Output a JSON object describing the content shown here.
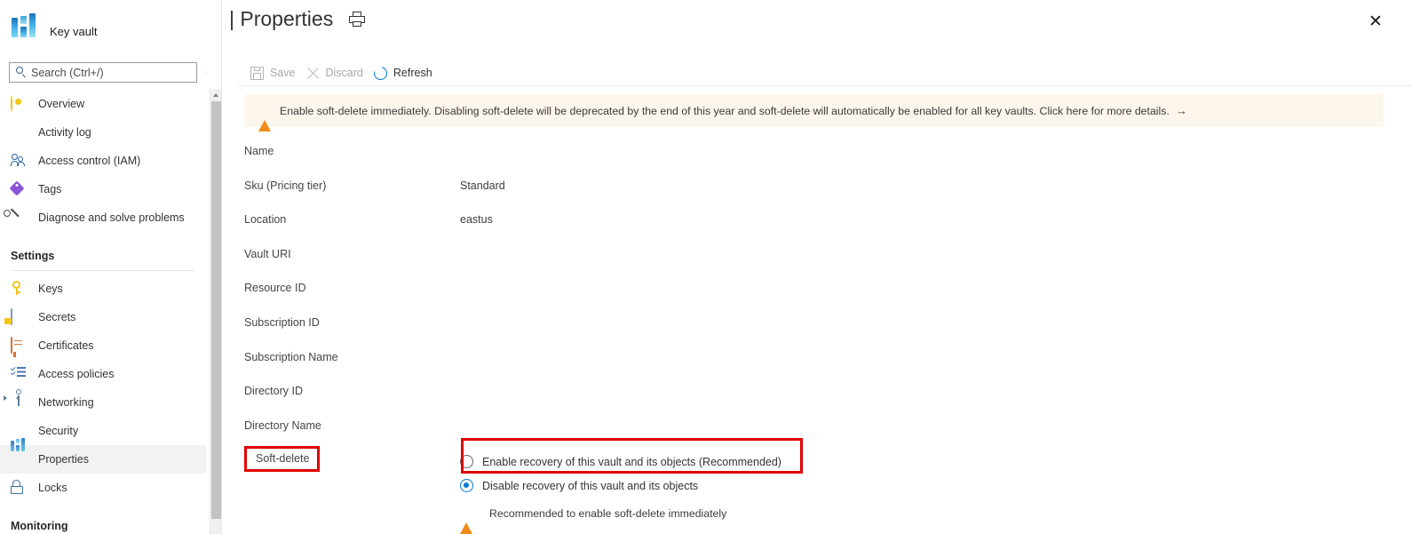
{
  "window": {
    "close_label": "✕"
  },
  "sidebar": {
    "brand": {
      "label": "Key vault",
      "icon": "key-vault-icon"
    },
    "search": {
      "placeholder": "Search (Ctrl+/)",
      "value": "",
      "icon": "search-icon"
    },
    "collapse": {
      "label": "«"
    },
    "items": [
      {
        "label": "Overview",
        "icon": "overview-icon",
        "selected": false
      },
      {
        "label": "Activity log",
        "icon": "activity-log-icon",
        "selected": false
      },
      {
        "label": "Access control (IAM)",
        "icon": "access-control-icon",
        "selected": false
      },
      {
        "label": "Tags",
        "icon": "tags-icon",
        "selected": false
      },
      {
        "label": "Diagnose and solve problems",
        "icon": "diagnose-icon",
        "selected": false
      }
    ],
    "settings_group": "Settings",
    "settings_items": [
      {
        "label": "Keys",
        "icon": "keys-icon",
        "selected": false
      },
      {
        "label": "Secrets",
        "icon": "secrets-icon",
        "selected": false
      },
      {
        "label": "Certificates",
        "icon": "certificates-icon",
        "selected": false
      },
      {
        "label": "Access policies",
        "icon": "access-policies-icon",
        "selected": false
      },
      {
        "label": "Networking",
        "icon": "networking-icon",
        "selected": false
      },
      {
        "label": "Security",
        "icon": "security-icon",
        "selected": false
      },
      {
        "label": "Properties",
        "icon": "properties-icon",
        "selected": true
      },
      {
        "label": "Locks",
        "icon": "locks-icon",
        "selected": false
      }
    ],
    "monitoring_group": "Monitoring"
  },
  "header": {
    "title": "| Properties",
    "print_icon": "print-icon"
  },
  "toolbar": {
    "save_label": "Save",
    "save_enabled": false,
    "discard_label": "Discard",
    "discard_enabled": false,
    "refresh_label": "Refresh",
    "refresh_enabled": true
  },
  "banner": {
    "text": "Enable soft-delete immediately. Disabling soft-delete will be deprecated by the end of this year and soft-delete will automatically be enabled for all key vaults. Click here for more details.",
    "arrow": "→",
    "background": "#fdf6ec",
    "icon_color": "#ef8c1b"
  },
  "properties": [
    {
      "label": "Name",
      "value": ""
    },
    {
      "label": "Sku (Pricing tier)",
      "value": "Standard"
    },
    {
      "label": "Location",
      "value": "eastus"
    },
    {
      "label": "Vault URI",
      "value": ""
    },
    {
      "label": "Resource ID",
      "value": ""
    },
    {
      "label": "Subscription ID",
      "value": ""
    },
    {
      "label": "Subscription Name",
      "value": ""
    },
    {
      "label": "Directory ID",
      "value": ""
    },
    {
      "label": "Directory Name",
      "value": ""
    }
  ],
  "soft_delete": {
    "label": "Soft-delete",
    "options": [
      {
        "label": "Enable recovery of this vault and its objects (Recommended)",
        "selected": false
      },
      {
        "label": "Disable recovery of this vault and its objects",
        "selected": true
      }
    ],
    "note": "Recommended to enable soft-delete immediately",
    "highlight_color": "#e00000"
  }
}
